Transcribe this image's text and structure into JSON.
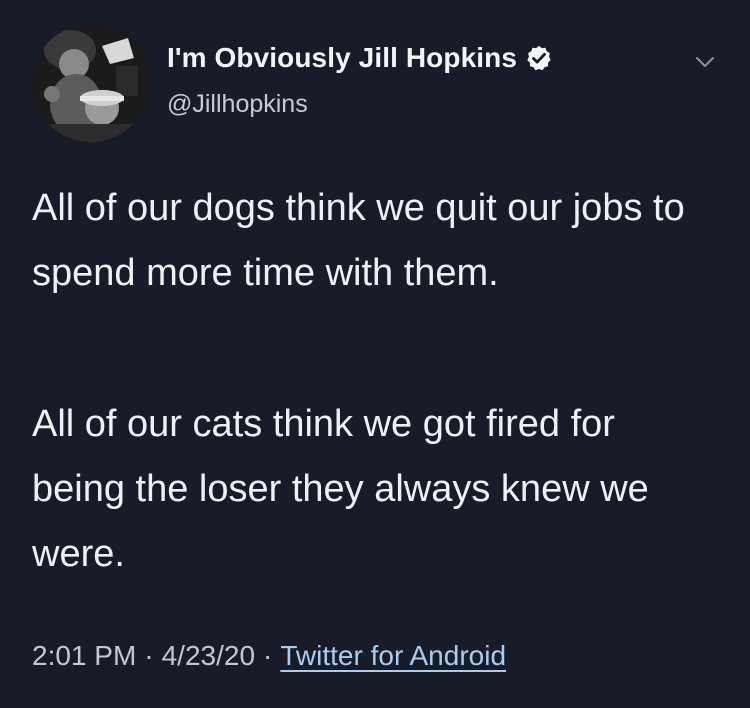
{
  "author": {
    "display_name": "I'm Obviously Jill Hopkins",
    "handle": "@Jillhopkins",
    "verified": true
  },
  "tweet": {
    "paragraph1": "All of our dogs think we quit our jobs to spend more time with them.",
    "paragraph2": "All of our cats think we got fired for being the loser they always knew we were."
  },
  "meta": {
    "time": "2:01 PM",
    "separator1": "·",
    "date": "4/23/20",
    "separator2": "·",
    "source": "Twitter for Android"
  },
  "icons": {
    "verified": "verified-badge-icon",
    "menu": "chevron-down-icon"
  },
  "colors": {
    "background": "#181c28",
    "text": "#eef1f4",
    "muted": "#c4c8ce",
    "link": "#a9cdf2"
  }
}
